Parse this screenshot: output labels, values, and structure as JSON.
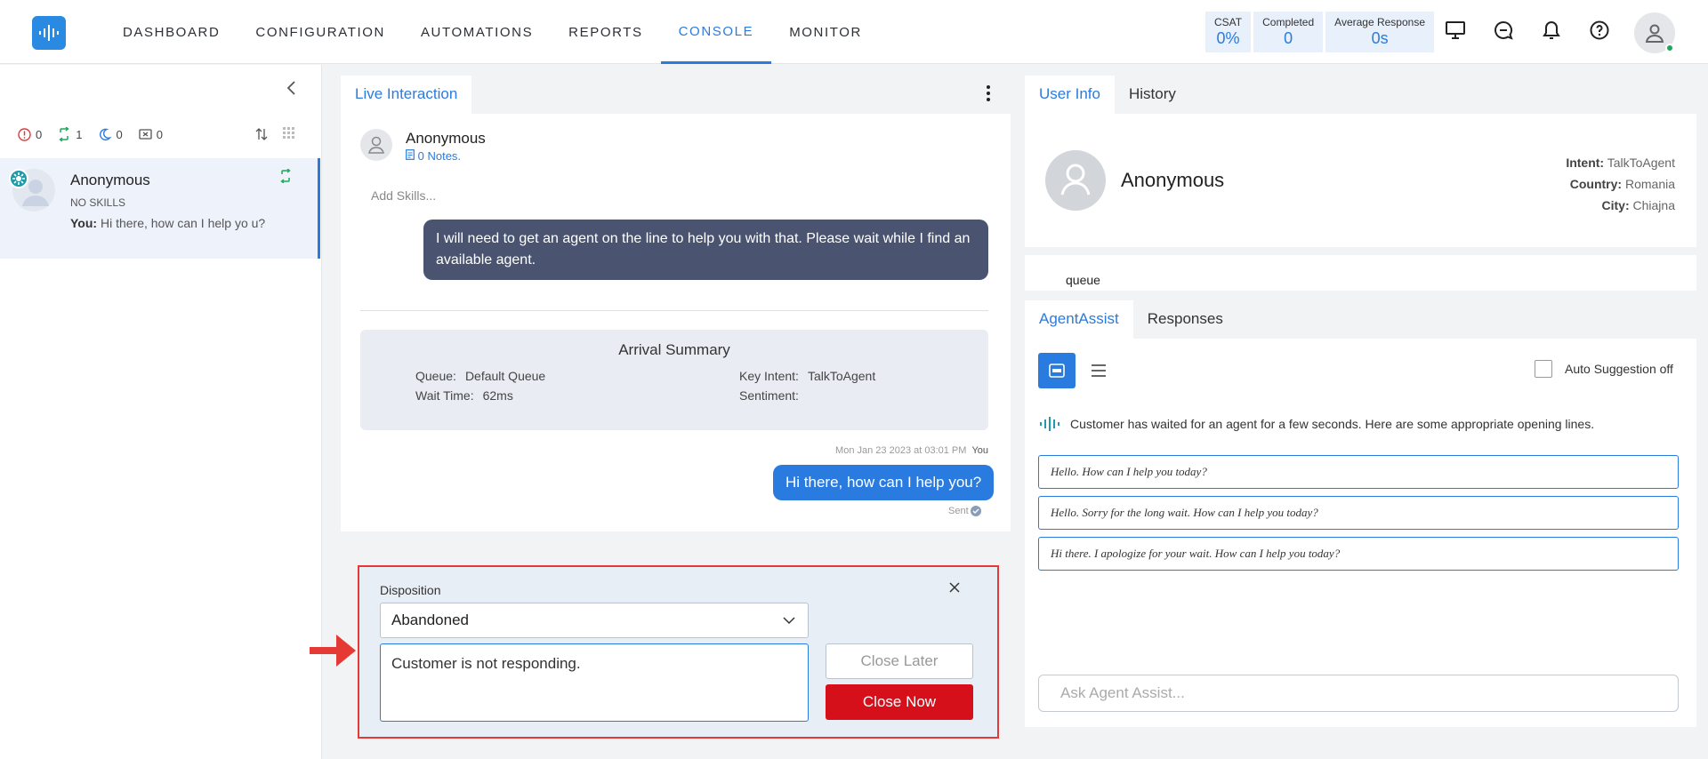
{
  "nav": {
    "items": [
      "DASHBOARD",
      "CONFIGURATION",
      "AUTOMATIONS",
      "REPORTS",
      "CONSOLE",
      "MONITOR"
    ],
    "active": "CONSOLE"
  },
  "stats": [
    {
      "label": "CSAT",
      "value": "0%"
    },
    {
      "label": "Completed",
      "value": "0"
    },
    {
      "label": "Average Response",
      "value": "0s"
    }
  ],
  "colors": {
    "accent": "#2a7be0",
    "danger": "#d6101b",
    "bot_bubble": "#4a5470"
  },
  "sidebar": {
    "counters": [
      {
        "icon": "alert-icon",
        "value": "0"
      },
      {
        "icon": "transfer-icon",
        "value": "1"
      },
      {
        "icon": "moon-icon",
        "value": "0"
      },
      {
        "icon": "closed-chat-icon",
        "value": "0"
      }
    ],
    "chat": {
      "name": "Anonymous",
      "skills": "NO SKILLS",
      "sender": "You:",
      "preview": "Hi there, how can I help yo u?"
    }
  },
  "center": {
    "tab": "Live Interaction",
    "customer_name": "Anonymous",
    "notes": "0 Notes.",
    "add_skills": "Add Skills...",
    "bot_message": "I will need to get an agent on the line to help you with that. Please wait while I find an available agent.",
    "summary": {
      "title": "Arrival Summary",
      "queue_label": "Queue:",
      "queue_value": "Default Queue",
      "wait_label": "Wait Time:",
      "wait_value": "62ms",
      "intent_label": "Key Intent:",
      "intent_value": "TalkToAgent",
      "sentiment_label": "Sentiment:",
      "sentiment_value": ""
    },
    "message_time": "Mon Jan 23 2023 at 03:01 PM",
    "message_author": "You",
    "agent_message": "Hi there, how can I help you?",
    "sent_label": "Sent"
  },
  "disposition": {
    "label": "Disposition",
    "selected": "Abandoned",
    "note": "Customer is not responding.",
    "close_later": "Close Later",
    "close_now": "Close Now"
  },
  "right": {
    "tabs": [
      "User Info",
      "History"
    ],
    "user_name": "Anonymous",
    "intent_label": "Intent:",
    "intent_value": "TalkToAgent",
    "country_label": "Country:",
    "country_value": "Romania",
    "city_label": "City:",
    "city_value": "Chiajna",
    "queue": "queue",
    "assist_tabs": [
      "AgentAssist",
      "Responses"
    ],
    "auto_suggestion": "Auto Suggestion off",
    "info_text": "Customer has waited for an agent for a few seconds. Here are some appropriate opening lines.",
    "suggestions": [
      "Hello. How can I help you today?",
      "Hello. Sorry for the long wait. How can I help you today?",
      "Hi there. I apologize for your wait. How can I help you today?"
    ],
    "ask_placeholder": "Ask Agent Assist..."
  }
}
